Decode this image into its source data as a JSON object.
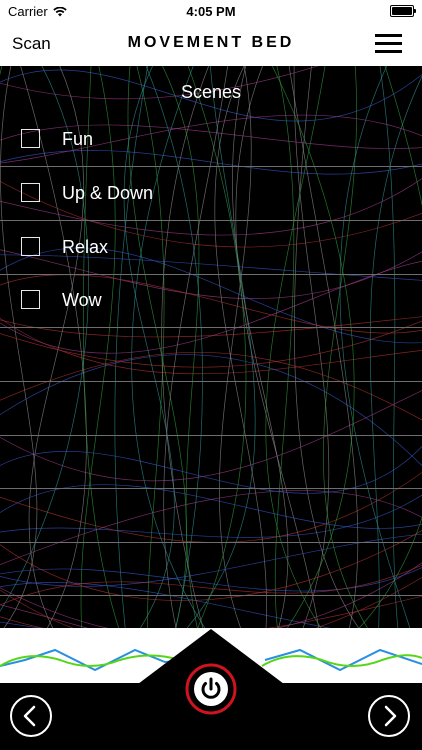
{
  "status_bar": {
    "carrier": "Carrier",
    "time": "4:05 PM"
  },
  "nav": {
    "scan_label": "Scan",
    "title": "MOVEMENT BED",
    "menu_icon": "hamburger-menu-icon"
  },
  "scenes": {
    "header": "Scenes",
    "items": [
      {
        "label": "Fun",
        "checked": false
      },
      {
        "label": "Up & Down",
        "checked": false
      },
      {
        "label": "Relax",
        "checked": false
      },
      {
        "label": "Wow",
        "checked": false
      }
    ]
  },
  "controls": {
    "prev_icon": "chevron-left-icon",
    "next_icon": "chevron-right-icon",
    "power_icon": "power-icon"
  },
  "colors": {
    "power_ring": "#d0141e",
    "wave_blue": "#2a8fe0",
    "wave_green": "#55d616"
  }
}
